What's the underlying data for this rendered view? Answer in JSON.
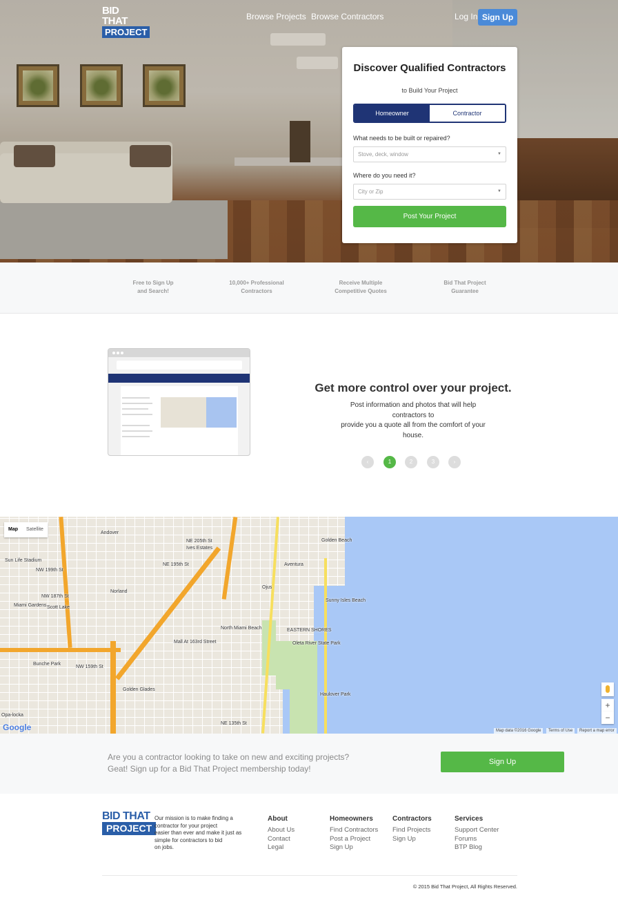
{
  "nav": {
    "logo_top": "BID THAT",
    "logo_bottom": "PROJECT",
    "links": [
      "Browse Projects",
      "Browse Contractors"
    ],
    "login": "Log In",
    "signup": "Sign Up"
  },
  "hero_card": {
    "title": "Discover Qualified Contractors",
    "subtitle": "to Build Your Project",
    "toggle": [
      "Homeowner",
      "Contractor"
    ],
    "q1_label": "What needs to be built or repaired?",
    "q1_placeholder": "Stove, deck, window",
    "q2_label": "Where do you need it?",
    "q2_placeholder": "City or Zip",
    "submit": "Post Your Project"
  },
  "features": [
    {
      "l1": "Free to Sign Up",
      "l2": "and Search!"
    },
    {
      "l1": "10,000+ Professional",
      "l2": "Contractors"
    },
    {
      "l1": "Receive Multiple",
      "l2": "Competitive Quotes"
    },
    {
      "l1": "Bid That Project",
      "l2": "Guarantee"
    }
  ],
  "control": {
    "title": "Get more control over your project.",
    "text_lines": [
      "Post information and photos that will help",
      "contractors to",
      "provide you a quote all from the comfort of your",
      "house."
    ],
    "pager": {
      "prev": "‹",
      "pages": [
        "1",
        "2",
        "3"
      ],
      "next": "›",
      "active": 1
    }
  },
  "map": {
    "toggle": [
      "Map",
      "Satellite"
    ],
    "labels": [
      "Andover",
      "Ives Estates",
      "Golden Beach",
      "Aventura",
      "Sun Life Stadium",
      "Norland",
      "Ojus",
      "Sunny Isles Beach",
      "Miami Gardens",
      "Scott Lake",
      "North Miami Beach",
      "EASTERN SHORES",
      "Mall At 163rd Street",
      "Oleta River State Park",
      "Bunche Park",
      "Golden Glades",
      "Haulover Park",
      "Opa-locka",
      "NW 199th St",
      "NE 205th St",
      "NW 187th St",
      "NE 195th St",
      "NW 159th St",
      "NE 135th St"
    ],
    "zoom_in": "+",
    "zoom_out": "−",
    "logo": "Google",
    "attrib": [
      "Map data ©2016 Google",
      "Terms of Use",
      "Report a map error"
    ]
  },
  "cta": {
    "line1": "Are you a contractor looking to take on new and exciting projects?",
    "line2": "Geat! Sign up for a Bid That Project membership today!",
    "button": "Sign Up"
  },
  "footer": {
    "mission_lines": [
      "Our mission is to make finding a",
      "contractor for your project",
      "easier than ever and make it just as",
      "simple for contractors to bid",
      "on jobs."
    ],
    "columns": [
      {
        "title": "About",
        "links": [
          "About Us",
          "Contact",
          "Legal"
        ]
      },
      {
        "title": "Homeowners",
        "links": [
          "Find Contractors",
          "Post a Project",
          "Sign Up"
        ]
      },
      {
        "title": "Contractors",
        "links": [
          "Find Projects",
          "Sign Up"
        ]
      },
      {
        "title": "Services",
        "links": [
          "Support Center",
          "Forums",
          "BTP Blog"
        ]
      }
    ],
    "copyright": "© 2015 Bid That Project, All Rights Reserved."
  },
  "colors": {
    "brand_blue": "#2a5ea8",
    "navy": "#1f3475",
    "green": "#55b847",
    "signup_blue": "#4a8ad8"
  }
}
